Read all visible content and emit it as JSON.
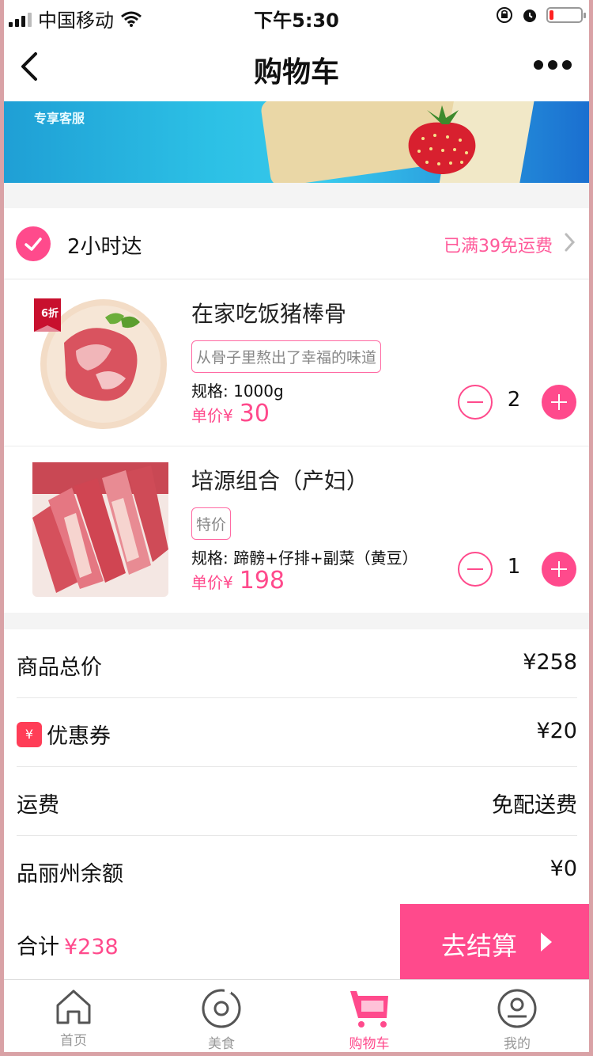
{
  "status_bar": {
    "carrier": "中国移动",
    "time": "下午5:30"
  },
  "nav": {
    "title": "购物车"
  },
  "banner": {
    "text": "专享客服"
  },
  "group": {
    "label": "2小时达",
    "shipping_note": "已满39免运费"
  },
  "items": [
    {
      "name": "在家吃饭猪棒骨",
      "tag": "从骨子里熬出了幸福的味道",
      "spec": "规格: 1000g",
      "price_label": "单价¥",
      "price": "30",
      "quantity": "2",
      "badge": "6折"
    },
    {
      "name": "培源组合（产妇）",
      "tag": "特价",
      "spec": "规格: 蹄髈+仔排+副菜（黄豆）",
      "price_label": "单价¥",
      "price": "198",
      "quantity": "1"
    }
  ],
  "summary": [
    {
      "label": "商品总价",
      "value": "¥258"
    },
    {
      "label": "优惠券",
      "value": "¥20",
      "icon": "coupon-icon",
      "icon_text": "¥"
    },
    {
      "label": "运费",
      "value": "免配送费"
    },
    {
      "label": "品丽州余额",
      "value": "¥0"
    }
  ],
  "footer": {
    "total_label": "合计",
    "total_value": "¥238",
    "checkout_label": "去结算"
  },
  "tabs": [
    {
      "label": "首页",
      "icon": "home-icon"
    },
    {
      "label": "美食",
      "icon": "food-icon"
    },
    {
      "label": "购物车",
      "icon": "cart-icon",
      "active": true
    },
    {
      "label": "我的",
      "icon": "profile-icon"
    }
  ],
  "colors": {
    "accent": "#ff4a8c",
    "frame": "#d9a2a6"
  }
}
